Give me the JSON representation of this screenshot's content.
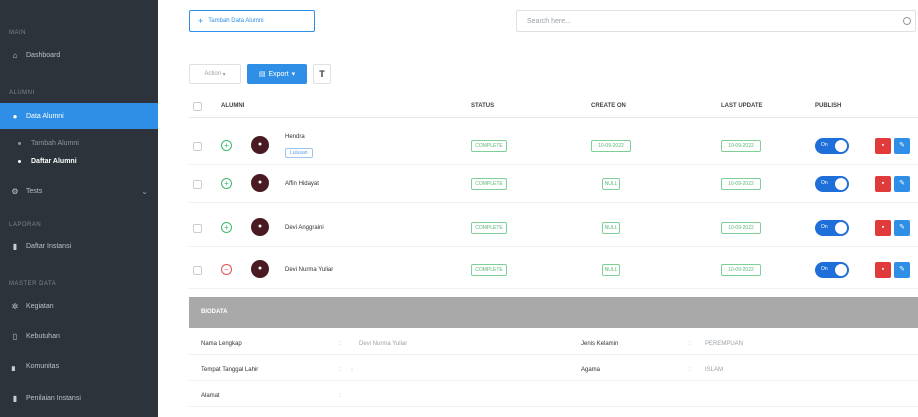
{
  "sidebar": {
    "sections": [
      "MAIN",
      "ALUMNI",
      "LAPORAN",
      "MASTER DATA"
    ],
    "dashboard": "Dashboard",
    "data_alumni": "Data Alumni",
    "sub_tambah": "Tambah Alumni",
    "sub_daftar": "Daftar Alumni",
    "tests": "Tests",
    "daftar_instansi": "Daftar Instansi",
    "kegiatan": "Kegiatan",
    "kebutuhan": "Kebutuhan",
    "komunitas": "Komunitas",
    "penilaian": "Penilaian Instansi"
  },
  "topbar": {
    "add_button": "Tambah Data Alumni",
    "search_placeholder": "Search here..."
  },
  "toolbar": {
    "action": "Action",
    "export": "Export",
    "filter": "T"
  },
  "table": {
    "headers": {
      "alumni": "ALUMNI",
      "status": "STATUS",
      "create_on": "CREATE ON",
      "last_update": "LAST UPDATE",
      "publish": "PUBLISH"
    },
    "rows": [
      {
        "name": "Hendra",
        "tag": "Lulusan",
        "status": "COMPLETE",
        "create": "10-09-2022",
        "update": "10-09-2022",
        "publish": "On"
      },
      {
        "name": "Affin Hidayat",
        "status": "COMPLETE",
        "create": "NULL",
        "update": "10-09-2022",
        "publish": "On"
      },
      {
        "name": "Devi Anggraini",
        "status": "COMPLETE",
        "create": "NULL",
        "update": "10-09-2022",
        "publish": "On"
      },
      {
        "name": "Devi Nurma Yuliar",
        "status": "COMPLETE",
        "create": "NULL",
        "update": "10-09-2022",
        "publish": "On"
      }
    ]
  },
  "detail": {
    "header": "BIODATA",
    "nama_label": "Nama Lengkap",
    "nama_value": "Devi Nurma Yuliar",
    "jk_label": "Jenis Kelamin",
    "jk_value": "PEREMPUAN",
    "ttl_label": "Tempat Tanggal Lahir",
    "ttl_value": "-",
    "agama_label": "Agama",
    "agama_value": "ISLAM",
    "alamat_label": "Alamat",
    "alamat_value": ""
  }
}
